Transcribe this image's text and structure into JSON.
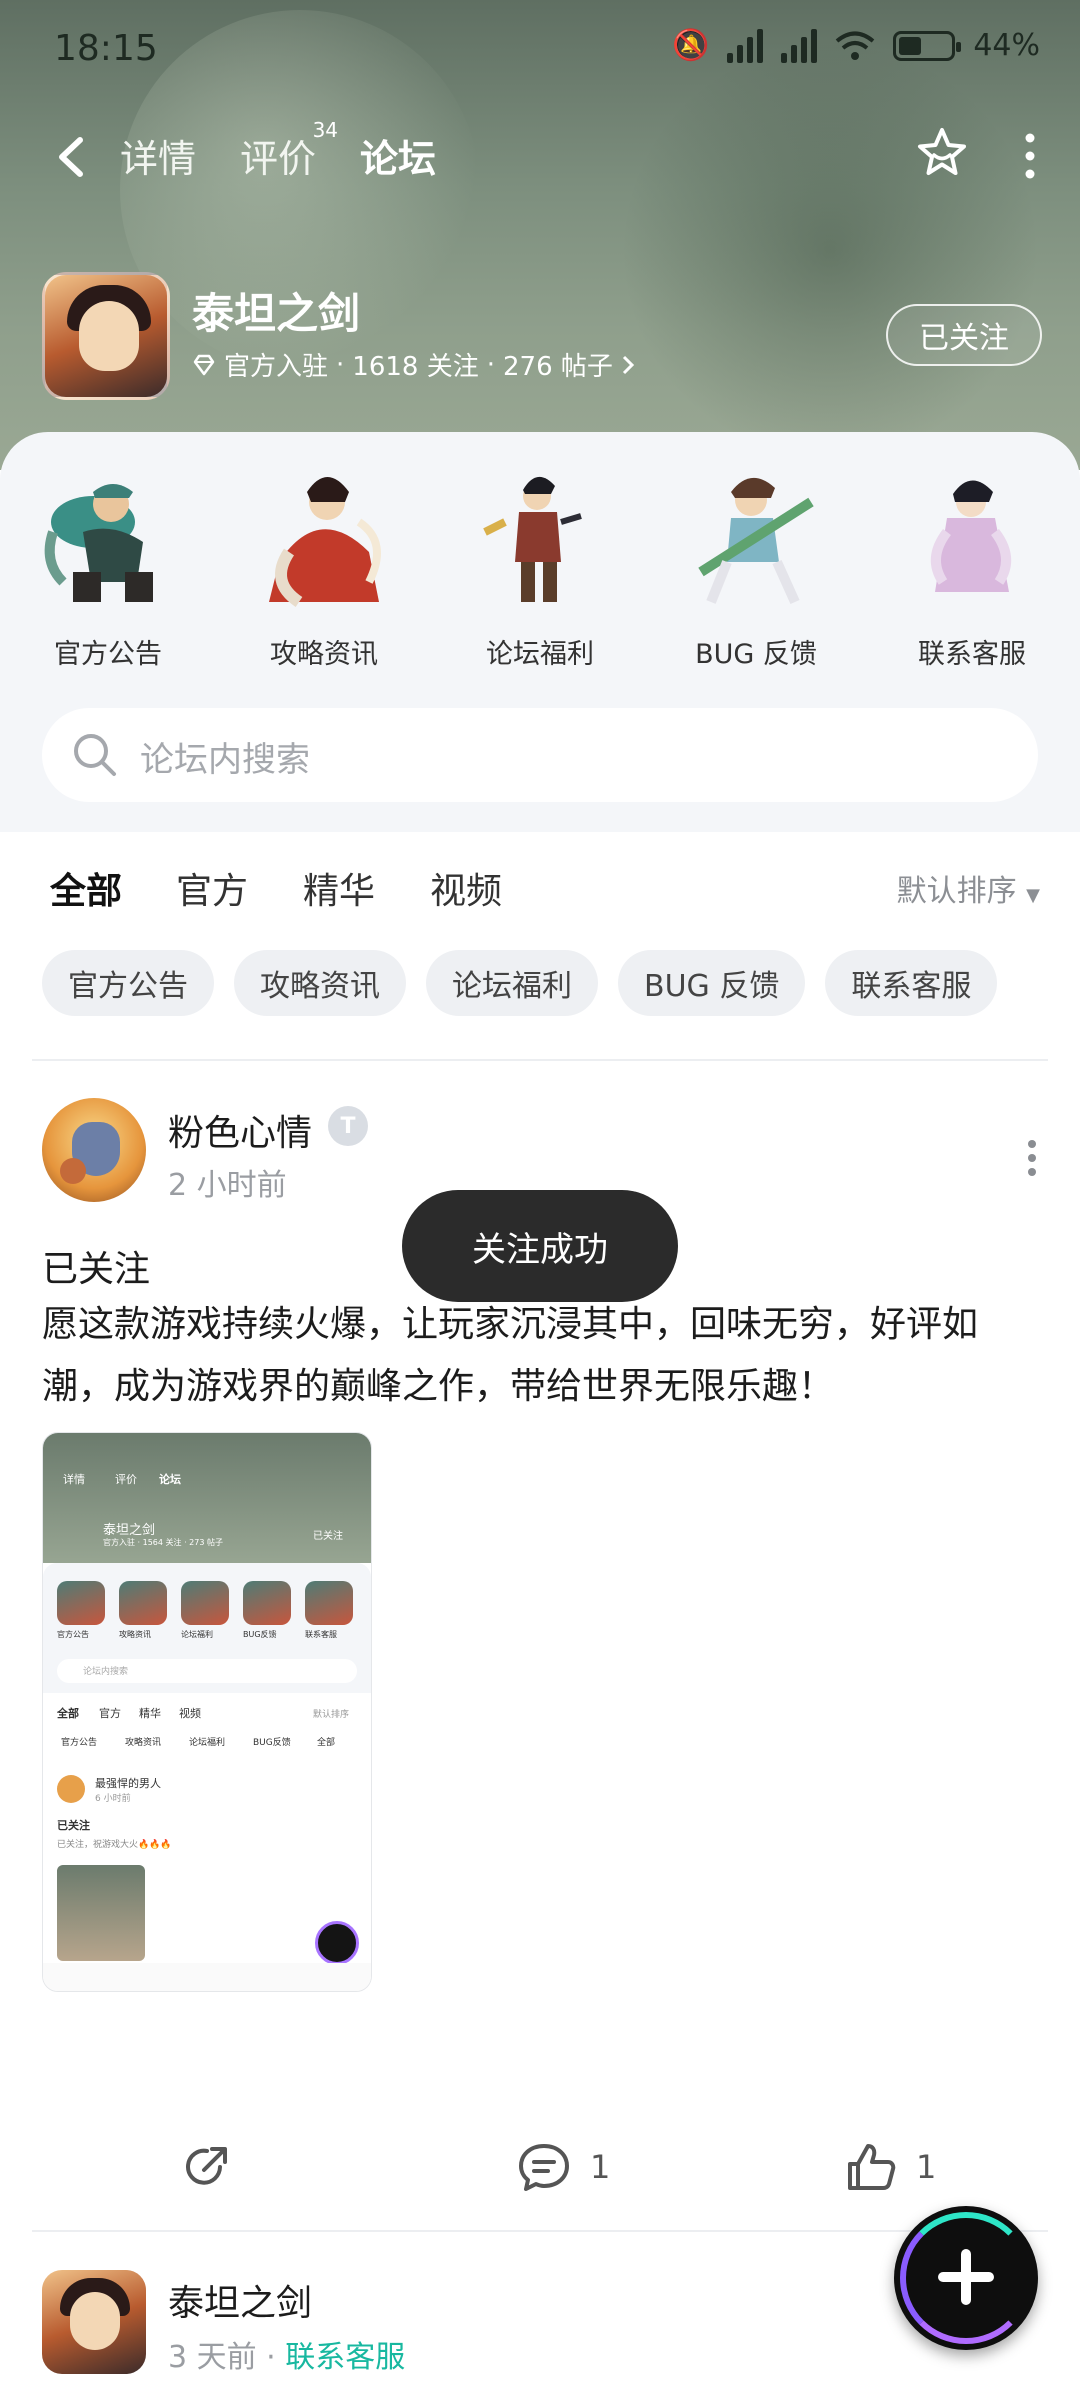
{
  "status_bar": {
    "time": "18:15",
    "battery": "44%",
    "battery_level": 0.44
  },
  "nav": {
    "tabs": [
      {
        "label": "详情"
      },
      {
        "label": "评价",
        "count": "34"
      },
      {
        "label": "论坛"
      }
    ],
    "active_tab": "论坛"
  },
  "game": {
    "name": "泰坦之剑",
    "official": "官方入驻",
    "follows": "1618 关注",
    "posts": "276 帖子",
    "sep": "·",
    "follow_label": "已关注"
  },
  "categories": [
    {
      "label": "官方公告"
    },
    {
      "label": "攻略资讯"
    },
    {
      "label": "论坛福利"
    },
    {
      "label": "BUG 反馈"
    },
    {
      "label": "联系客服"
    }
  ],
  "search": {
    "placeholder": "论坛内搜索"
  },
  "filter_tabs": {
    "items": [
      "全部",
      "官方",
      "精华",
      "视频"
    ],
    "sort_label": "默认排序"
  },
  "chips": [
    "官方公告",
    "攻略资讯",
    "论坛福利",
    "BUG 反馈",
    "联系客服"
  ],
  "post": {
    "author": "粉色心情",
    "badge": "T",
    "time": "2 小时前",
    "title": "已关注",
    "body": "愿这款游戏持续火爆，让玩家沉浸其中，回味无穷，好评如潮，成为游戏界的巅峰之作，带给世界无限乐趣！",
    "comments": "1",
    "likes": "1",
    "thumb": {
      "nav_tabs": [
        "详情",
        "评价",
        "论坛"
      ],
      "game_name": "泰坦之剑",
      "game_meta": "官方入驻 · 1564 关注 · 273 帖子",
      "follow_label": "已关注",
      "categories": [
        "官方公告",
        "攻略资讯",
        "论坛福利",
        "BUG反馈",
        "联系客服"
      ],
      "search_placeholder": "论坛内搜索",
      "filters": [
        "全部",
        "官方",
        "精华",
        "视频"
      ],
      "sort_label": "默认排序",
      "chips": [
        "官方公告",
        "攻略资讯",
        "论坛福利",
        "BUG反馈",
        "全部"
      ],
      "author": "最强悍的男人",
      "time": "6 小时前",
      "title": "已关注",
      "body": "已关注，祝游戏大火🔥🔥🔥"
    }
  },
  "post2": {
    "author": "泰坦之剑",
    "time": "3 天前",
    "sep": "·",
    "category": "联系客服"
  },
  "toast": {
    "text": "关注成功"
  },
  "colors": {
    "accent": "#23d6bd",
    "link": "#18b8a0",
    "toast_bg": "#2b2b2b"
  }
}
